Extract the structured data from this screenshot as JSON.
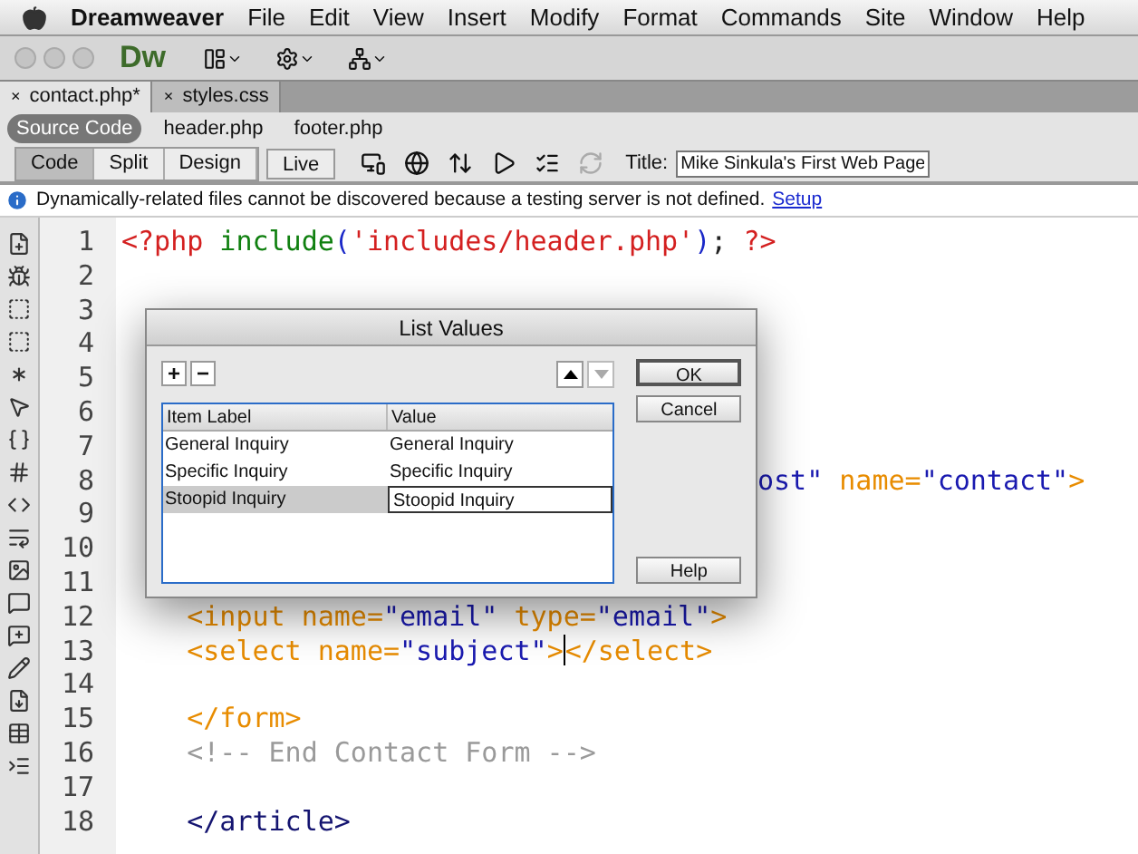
{
  "menu_bar": {
    "app": "Dreamweaver",
    "items": [
      "File",
      "Edit",
      "View",
      "Insert",
      "Modify",
      "Format",
      "Commands",
      "Site",
      "Window",
      "Help"
    ]
  },
  "toolbar": {
    "logo": "Dw"
  },
  "tabs": [
    {
      "close": "×",
      "label": "contact.php*",
      "selected": true
    },
    {
      "close": "×",
      "label": "styles.css",
      "selected": false
    }
  ],
  "related_files": [
    {
      "label": "Source Code",
      "selected": true
    },
    {
      "label": "header.php",
      "selected": false
    },
    {
      "label": "footer.php",
      "selected": false
    }
  ],
  "view_buttons": [
    {
      "label": "Code",
      "selected": true
    },
    {
      "label": "Split",
      "selected": false
    },
    {
      "label": "Design",
      "selected": false
    }
  ],
  "live_button": "Live",
  "title_field": {
    "label": "Title:",
    "value": "Mike Sinkula's First Web Page"
  },
  "info_bar": {
    "message": "Dynamically-related files cannot be discovered because a testing server is not defined.",
    "link": "Setup"
  },
  "code_lines": [
    {
      "number": "1",
      "tokens": [
        {
          "kind": "php",
          "text": "<?php"
        },
        {
          "kind": "func",
          "text": " include"
        },
        {
          "kind": "paren",
          "text": "("
        },
        {
          "kind": "php",
          "text": "'includes/header.php'"
        },
        {
          "kind": "paren",
          "text": ")"
        },
        {
          "kind": "plain",
          "text": "; "
        },
        {
          "kind": "php",
          "text": "?>"
        }
      ]
    },
    {
      "number": "2"
    },
    {
      "number": "3"
    },
    {
      "number": "4"
    },
    {
      "number": "5"
    },
    {
      "number": "6"
    },
    {
      "number": "7"
    },
    {
      "number": "8",
      "partial": true,
      "tokens": [
        {
          "kind": "value",
          "text": "ost\""
        },
        {
          "kind": "tag",
          "text": " name="
        },
        {
          "kind": "value",
          "text": "\"contact\""
        },
        {
          "kind": "tag",
          "text": ">"
        }
      ]
    },
    {
      "number": "9"
    },
    {
      "number": "10"
    },
    {
      "number": "11"
    },
    {
      "number": "12",
      "tokens": [
        {
          "kind": "tag",
          "text": "    <input name="
        },
        {
          "kind": "value",
          "text": "\"email\""
        },
        {
          "kind": "tag",
          "text": " type="
        },
        {
          "kind": "value",
          "text": "\"email\""
        },
        {
          "kind": "tag",
          "text": ">"
        }
      ]
    },
    {
      "number": "13",
      "tokens": [
        {
          "kind": "tag",
          "text": "    <select name="
        },
        {
          "kind": "value",
          "text": "\"subject\""
        },
        {
          "kind": "tag",
          "text": ">"
        },
        {
          "kind": "caret"
        },
        {
          "kind": "tag",
          "text": "</select>"
        }
      ]
    },
    {
      "number": "14"
    },
    {
      "number": "15",
      "tokens": [
        {
          "kind": "tag",
          "text": "    </form>"
        }
      ]
    },
    {
      "number": "16",
      "tokens": [
        {
          "kind": "comment",
          "text": "    <!-- End Contact Form -->"
        }
      ]
    },
    {
      "number": "17"
    },
    {
      "number": "18",
      "tokens": [
        {
          "kind": "block",
          "text": "    </article>"
        }
      ]
    }
  ],
  "dialog": {
    "title": "List Values",
    "add": "+",
    "remove": "−",
    "move_down_disabled": true,
    "columns": [
      "Item Label",
      "Value"
    ],
    "rows": [
      {
        "label": "General Inquiry",
        "value": "General Inquiry",
        "selected": false
      },
      {
        "label": "Specific Inquiry",
        "value": "Specific Inquiry",
        "selected": false
      },
      {
        "label": "Stoopid Inquiry",
        "value": "Stoopid Inquiry",
        "selected": true
      }
    ],
    "buttons": [
      {
        "label": "OK",
        "kind": "default"
      },
      {
        "label": "Cancel",
        "kind": "normal"
      },
      {
        "label": "Help",
        "kind": "help"
      }
    ]
  }
}
